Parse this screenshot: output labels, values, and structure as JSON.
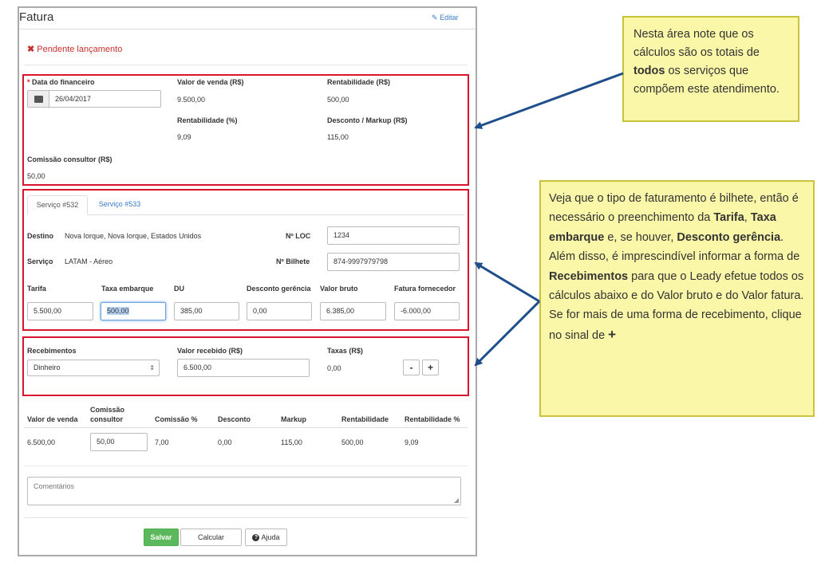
{
  "header": {
    "title": "Fatura",
    "edit_label": "Editar"
  },
  "status": {
    "text": "Pendente lançamento"
  },
  "financeiro": {
    "data_label": "Data do financeiro",
    "data_value": "26/04/2017",
    "valor_venda_label": "Valor de venda (R$)",
    "valor_venda_value": "9.500,00",
    "rentabilidade_label": "Rentabilidade (R$)",
    "rentabilidade_value": "500,00",
    "rentabilidade_pct_label": "Rentabilidade (%)",
    "rentabilidade_pct_value": "9,09",
    "desconto_markup_label": "Desconto / Markup (R$)",
    "desconto_markup_value": "115,00",
    "comissao_label": "Comissão consultor (R$)",
    "comissao_value": "50,00"
  },
  "servicos": {
    "tabs": [
      {
        "label": "Serviço #532"
      },
      {
        "label": "Serviço #533"
      }
    ],
    "destino_label": "Destino",
    "destino_value": "Nova Iorque, Nova Iorque, Estados Unidos",
    "loc_label": "Nº LOC",
    "loc_value": "1234",
    "servico_label": "Serviço",
    "servico_value": "LATAM - Aéreo",
    "bilhete_label": "Nº Bilhete",
    "bilhete_value": "874-9997979798",
    "fields": [
      {
        "label": "Tarifa",
        "value": "5.500,00"
      },
      {
        "label": "Taxa embarque",
        "value": "500,00"
      },
      {
        "label": "DU",
        "value": "385,00"
      },
      {
        "label": "Desconto gerência",
        "value": "0,00"
      },
      {
        "label": "Valor bruto",
        "value": "6.385,00"
      },
      {
        "label": "Fatura fornecedor",
        "value": "-6.000,00"
      }
    ]
  },
  "recebimentos": {
    "label": "Recebimentos",
    "selected": "Dinheiro",
    "valor_label": "Valor recebido (R$)",
    "valor_value": "6.500,00",
    "taxas_label": "Taxas (R$)",
    "taxas_value": "0,00",
    "minus": "-",
    "plus": "+"
  },
  "summary": {
    "headers": [
      "Valor de venda",
      "Comissão consultor",
      "Comissão %",
      "Desconto",
      "Markup",
      "Rentabilidade",
      "Rentabilidade %"
    ],
    "values": [
      "6.500,00",
      "50,00",
      "7,00",
      "0,00",
      "115,00",
      "500,00",
      "9,09"
    ]
  },
  "comments": {
    "placeholder": "Comentários"
  },
  "buttons": {
    "save": "Salvar",
    "calc": "Calcular",
    "help": "Ajuda"
  },
  "notes": {
    "note1": {
      "p1": "Nesta área note que os cálculos são os totais de ",
      "b1": "todos",
      "p2": " os serviços que compõem este atendimento."
    },
    "note2": {
      "p1": "Veja que o tipo de faturamento é bilhete, então é necessário o preenchimento da ",
      "b1": "Tarifa",
      "p2": ", ",
      "b2": "Taxa embarque",
      "p3": " e, se houver, ",
      "b3": "Desconto gerência",
      "p4": ".",
      "p5": "Além disso, é imprescindível informar a forma de ",
      "b4": "Recebimentos",
      "p6": " para que o Leady efetue todos os cálculos abaixo e do Valor bruto e do Valor fatura.",
      "p7": "Se for mais de uma forma de recebimento, clique no sinal de ",
      "b5": "+"
    }
  }
}
